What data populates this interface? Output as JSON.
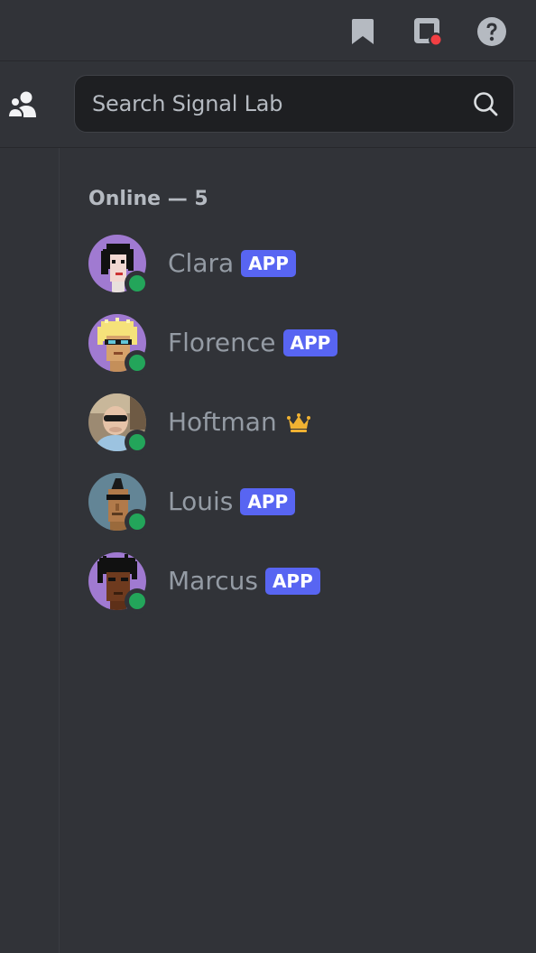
{
  "topbar": {
    "icons": [
      "bookmark-icon",
      "inbox-icon",
      "help-icon"
    ],
    "inbox_unread_color": "#f23f43"
  },
  "search": {
    "placeholder": "Search Signal Lab"
  },
  "members": {
    "section_header": "Online — 5",
    "status_color": "#23a55a",
    "badge_color": "#5865f2",
    "items": [
      {
        "name": "Clara",
        "badge": "APP",
        "status": "online"
      },
      {
        "name": "Florence",
        "badge": "APP",
        "status": "online"
      },
      {
        "name": "Hoftman",
        "badge": "",
        "owner_icon": "crown-icon",
        "status": "online"
      },
      {
        "name": "Louis",
        "badge": "APP",
        "status": "online"
      },
      {
        "name": "Marcus",
        "badge": "APP",
        "status": "online"
      }
    ]
  }
}
